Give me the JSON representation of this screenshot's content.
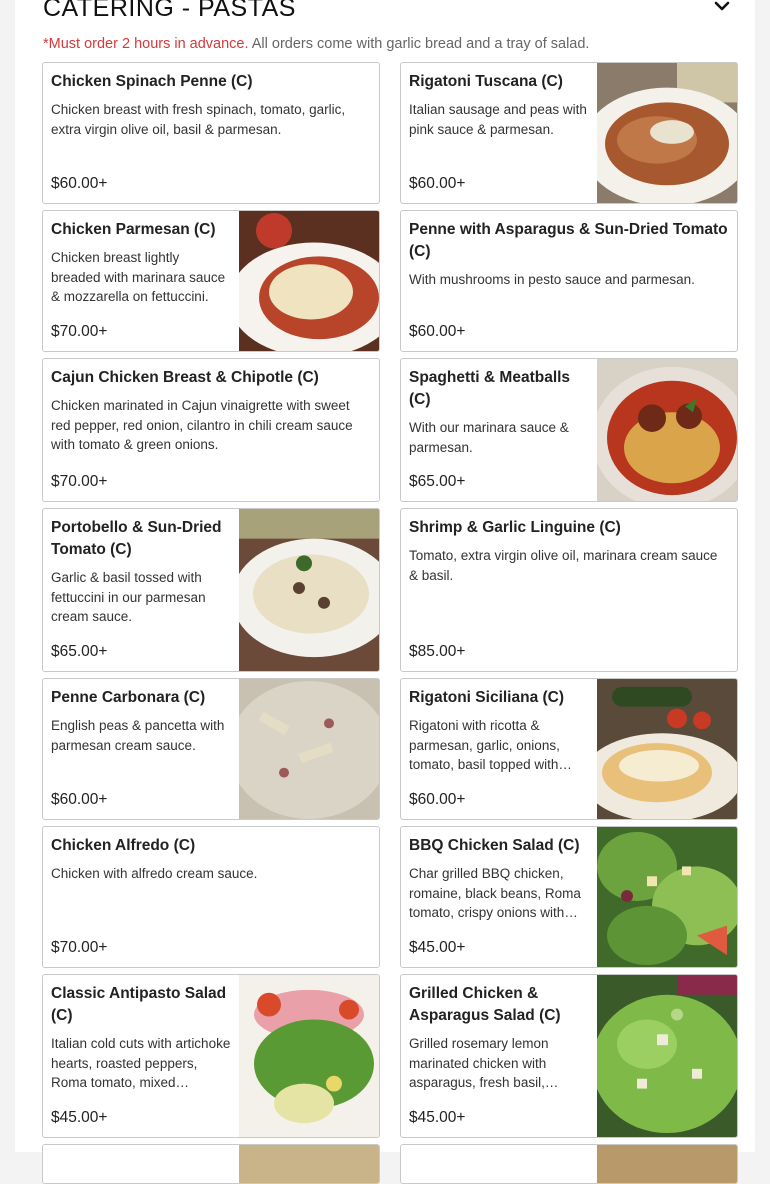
{
  "section": {
    "title": "CATERING - PASTAS",
    "notice_warning": "*Must order 2 hours in advance.",
    "notice_info": "All orders come with garlic bread and a tray of salad."
  },
  "items": [
    {
      "name": "Chicken Spinach Penne (C)",
      "desc": "Chicken breast with fresh spinach, tomato, garlic, extra virgin olive oil, basil & parmesan.",
      "price": "$60.00+"
    },
    {
      "name": "Rigatoni Tuscana (C)",
      "desc": "Italian sausage and peas with pink sauce & parmesan.",
      "price": "$60.00+"
    },
    {
      "name": "Chicken Parmesan (C)",
      "desc": "Chicken breast lightly breaded with marinara sauce & mozzarella on fettuccini.",
      "price": "$70.00+"
    },
    {
      "name": "Penne with Asparagus & Sun-Dried Tomato (C)",
      "desc": "With mushrooms in pesto sauce and parmesan.",
      "price": "$60.00+"
    },
    {
      "name": "Cajun Chicken Breast & Chipotle (C)",
      "desc": "Chicken marinated in Cajun vinaigrette with sweet red pepper, red onion, cilantro in chili cream sauce with tomato & green onions.",
      "price": "$70.00+"
    },
    {
      "name": "Spaghetti & Meatballs (C)",
      "desc": "With our marinara sauce & parmesan.",
      "price": "$65.00+"
    },
    {
      "name": "Portobello & Sun-Dried Tomato (C)",
      "desc": "Garlic & basil tossed with fettuccini in our parmesan cream sauce.",
      "price": "$65.00+"
    },
    {
      "name": "Shrimp & Garlic Linguine (C)",
      "desc": "Tomato, extra virgin olive oil, marinara cream sauce & basil.",
      "price": "$85.00+"
    },
    {
      "name": "Penne Carbonara (C)",
      "desc": "English peas & pancetta with parmesan cream sauce.",
      "price": "$60.00+"
    },
    {
      "name": "Rigatoni Siciliana (C)",
      "desc": "Rigatoni with ricotta & parmesan, garlic, onions, tomato, basil topped with…",
      "price": "$60.00+"
    },
    {
      "name": "Chicken Alfredo (C)",
      "desc": "Chicken with alfredo cream sauce.",
      "price": "$70.00+"
    },
    {
      "name": "BBQ Chicken Salad (C)",
      "desc": "Char grilled BBQ chicken, romaine, black beans, Roma tomato, crispy onions with…",
      "price": "$45.00+"
    },
    {
      "name": "Classic Antipasto Salad (C)",
      "desc": "Italian cold cuts with artichoke hearts, roasted peppers, Roma tomato, mixed lettuces…",
      "price": "$45.00+"
    },
    {
      "name": "Grilled Chicken & Asparagus Salad (C)",
      "desc": "Grilled rosemary lemon marinated chicken with asparagus, fresh basil, lettuc…",
      "price": "$45.00+"
    }
  ]
}
